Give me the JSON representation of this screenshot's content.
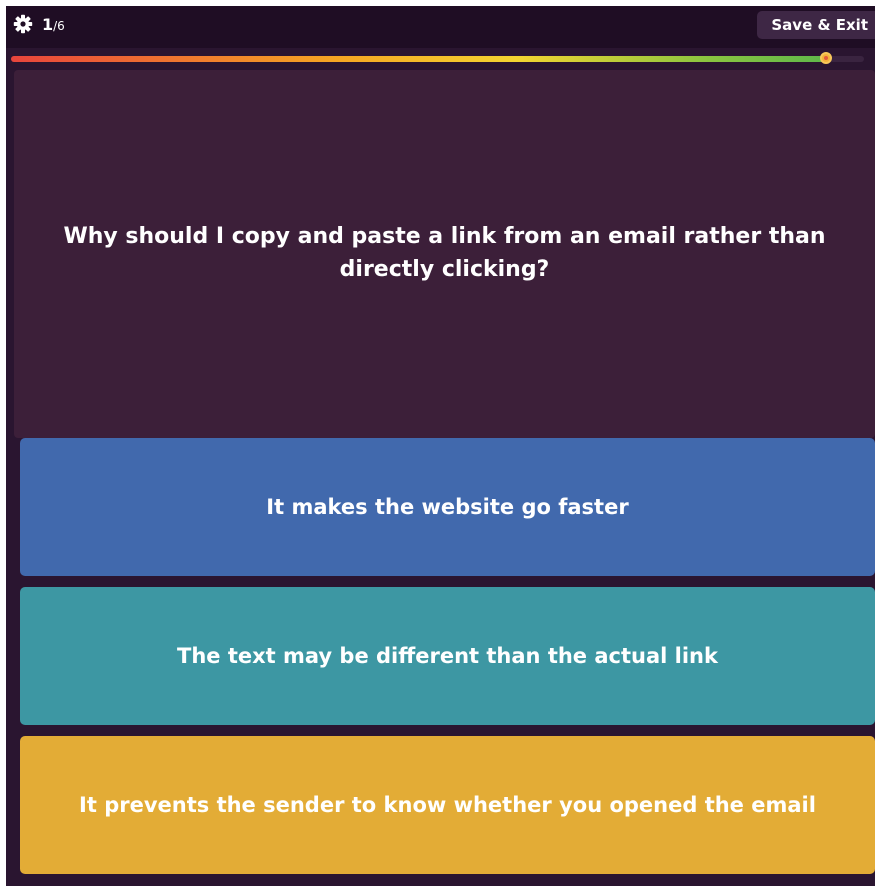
{
  "header": {
    "settings_icon": "gear-icon",
    "current_question": "1",
    "total_questions": "/6",
    "save_exit_label": "Save & Exit"
  },
  "progress": {
    "fraction": 0.955
  },
  "question": {
    "text": "Why should I copy and paste a link from an email rather than directly clicking?"
  },
  "answers": [
    {
      "text": "It makes the website go faster",
      "color": "#4169ad"
    },
    {
      "text": "The text may be different than the actual link",
      "color": "#3d97a3"
    },
    {
      "text": "It prevents the sender to know whether you opened the email",
      "color": "#e3ac36"
    }
  ],
  "colors": {
    "background": "#2a1530",
    "topbar": "#1f0d24",
    "question_card": "#3c1f39"
  }
}
